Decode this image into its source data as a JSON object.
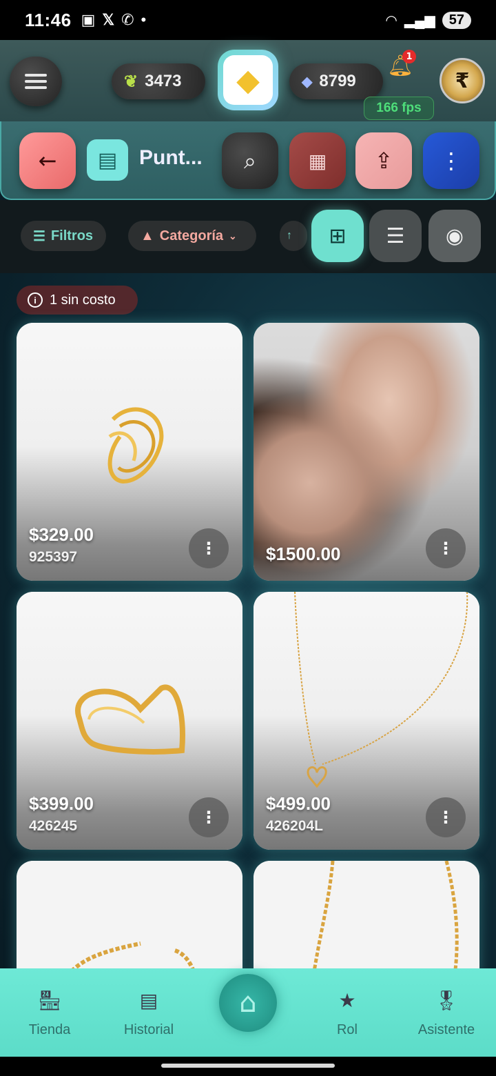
{
  "status_bar": {
    "time": "11:46",
    "battery": "57"
  },
  "header": {
    "leaf_count": "3473",
    "gem_count": "8799",
    "notification_count": "1",
    "fps": "166 fps"
  },
  "action_bar": {
    "title": "Punt..."
  },
  "filters": {
    "filtros_label": "Filtros",
    "categoria_label": "Categoría"
  },
  "info_pill": {
    "label": "1 sin costo"
  },
  "products": [
    {
      "price": "$329.00",
      "sku": "925397"
    },
    {
      "price": "$1500.00",
      "sku": ""
    },
    {
      "price": "$399.00",
      "sku": "426245"
    },
    {
      "price": "$499.00",
      "sku": "426204L"
    }
  ],
  "bottom_nav": {
    "tienda": "Tienda",
    "historial": "Historial",
    "rol": "Rol",
    "asistente": "Asistente"
  }
}
